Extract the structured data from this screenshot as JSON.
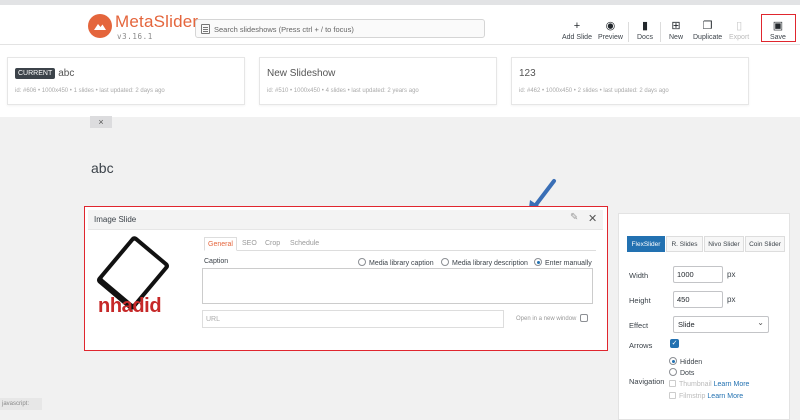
{
  "brand": {
    "name": "MetaSlider",
    "version": "v3.16.1"
  },
  "search": {
    "placeholder": "Search slideshows (Press ctrl + / to focus)"
  },
  "toolbar": {
    "add_slide": "Add Slide",
    "preview": "Preview",
    "docs": "Docs",
    "new": "New",
    "duplicate": "Duplicate",
    "export": "Export",
    "save": "Save"
  },
  "slideshows": [
    {
      "badge": "CURRENT",
      "name": "abc",
      "meta": "id: #606 • 1000x450 • 1 slides • last updated: 2 days ago"
    },
    {
      "badge": "",
      "name": "New Slideshow",
      "meta": "id: #510 • 1000x450 • 4 slides • last updated: 2 years ago"
    },
    {
      "badge": "",
      "name": "123",
      "meta": "id: #462 • 1000x450 • 2 slides • last updated: 2 days ago"
    }
  ],
  "close_tab": "×",
  "current_title": "abc",
  "slide": {
    "title": "Image Slide",
    "thumb_text": "nhadid",
    "tabs": [
      "General",
      "SEO",
      "Crop",
      "Schedule"
    ],
    "caption_label": "Caption",
    "caption_sources": [
      "Media library caption",
      "Media library description",
      "Enter manually"
    ],
    "caption_selected": "Enter manually",
    "caption_value": "",
    "url_placeholder": "URL",
    "new_window_label": "Open in a new window"
  },
  "settings": {
    "slider_tabs": [
      "FlexSlider",
      "R. Slides",
      "Nivo Slider",
      "Coin Slider"
    ],
    "active_tab": "FlexSlider",
    "width_label": "Width",
    "width_value": "1000",
    "height_label": "Height",
    "height_value": "450",
    "unit": "px",
    "effect_label": "Effect",
    "effect_value": "Slide",
    "arrows_label": "Arrows",
    "arrows_checked": true,
    "navigation_label": "Navigation",
    "nav_options": {
      "hidden": "Hidden",
      "dots": "Dots",
      "thumbnail": "Thumbnail",
      "filmstrip": "Filmstrip",
      "learn_more": "Learn More"
    },
    "nav_selected": "Hidden"
  },
  "status": {
    "text": "javascript:"
  },
  "colors": {
    "brand": "#e4653c",
    "accent": "#2271b1",
    "highlight": "#e0262e"
  }
}
